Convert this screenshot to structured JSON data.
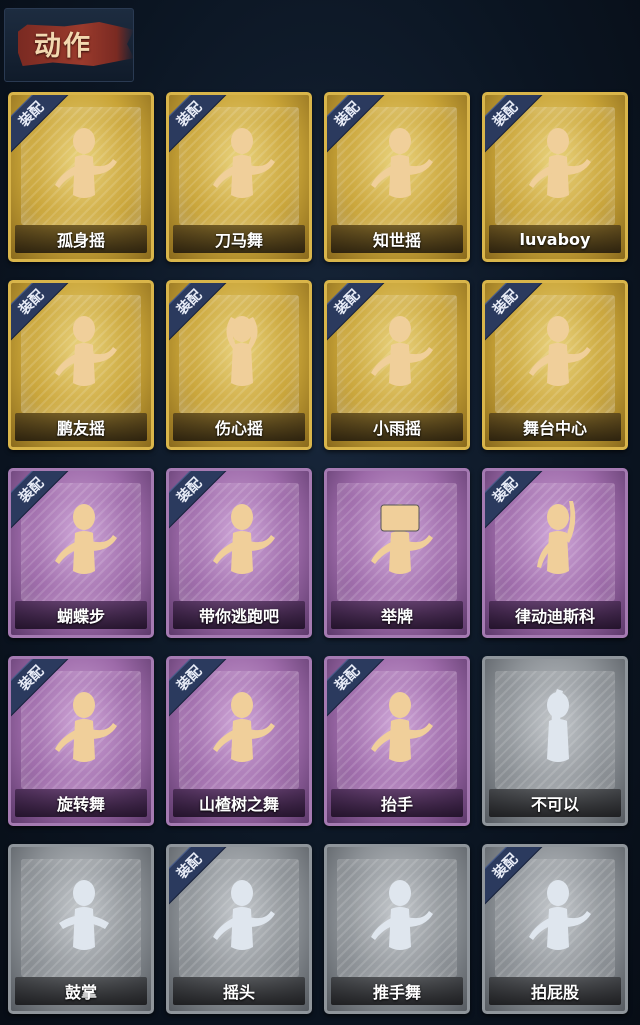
{
  "header": {
    "title": "动作"
  },
  "badge_label": "装配",
  "colors": {
    "gold": "#c9a437",
    "purple": "#9d6aa9",
    "gray": "#8c9196",
    "figure_gold": "#f0cf9a",
    "figure_gray": "#dfe6ee"
  },
  "cards": [
    {
      "label": "孤身摇",
      "tier": "gold",
      "equipped": true,
      "icon": "dancer-icon"
    },
    {
      "label": "刀马舞",
      "tier": "gold",
      "equipped": true,
      "icon": "dancer-icon"
    },
    {
      "label": "知世摇",
      "tier": "gold",
      "equipped": true,
      "icon": "dancer-icon"
    },
    {
      "label": "luvaboy",
      "tier": "gold",
      "equipped": true,
      "icon": "dancer-icon"
    },
    {
      "label": "鹏友摇",
      "tier": "gold",
      "equipped": true,
      "icon": "dancer-icon"
    },
    {
      "label": "伤心摇",
      "tier": "gold",
      "equipped": true,
      "icon": "heart-hands-icon"
    },
    {
      "label": "小雨摇",
      "tier": "gold",
      "equipped": true,
      "icon": "dancer-icon"
    },
    {
      "label": "舞台中心",
      "tier": "gold",
      "equipped": true,
      "icon": "dancer-icon"
    },
    {
      "label": "蝴蝶步",
      "tier": "purple",
      "equipped": true,
      "icon": "dancer-icon"
    },
    {
      "label": "带你逃跑吧",
      "tier": "purple",
      "equipped": true,
      "icon": "dancer-icon"
    },
    {
      "label": "举牌",
      "tier": "purple",
      "equipped": false,
      "icon": "sign-holder-icon"
    },
    {
      "label": "律动迪斯科",
      "tier": "purple",
      "equipped": true,
      "icon": "disco-icon"
    },
    {
      "label": "旋转舞",
      "tier": "purple",
      "equipped": true,
      "icon": "spin-dancer-icon"
    },
    {
      "label": "山楂树之舞",
      "tier": "purple",
      "equipped": true,
      "icon": "dancer-icon"
    },
    {
      "label": "抬手",
      "tier": "purple",
      "equipped": true,
      "icon": "raise-hand-icon"
    },
    {
      "label": "不可以",
      "tier": "gray",
      "equipped": false,
      "icon": "finger-wag-icon"
    },
    {
      "label": "鼓掌",
      "tier": "gray",
      "equipped": false,
      "icon": "clap-icon"
    },
    {
      "label": "摇头",
      "tier": "gray",
      "equipped": true,
      "icon": "dancer-icon"
    },
    {
      "label": "推手舞",
      "tier": "gray",
      "equipped": false,
      "icon": "dancer-icon"
    },
    {
      "label": "拍屁股",
      "tier": "gray",
      "equipped": true,
      "icon": "dancer-icon"
    }
  ]
}
